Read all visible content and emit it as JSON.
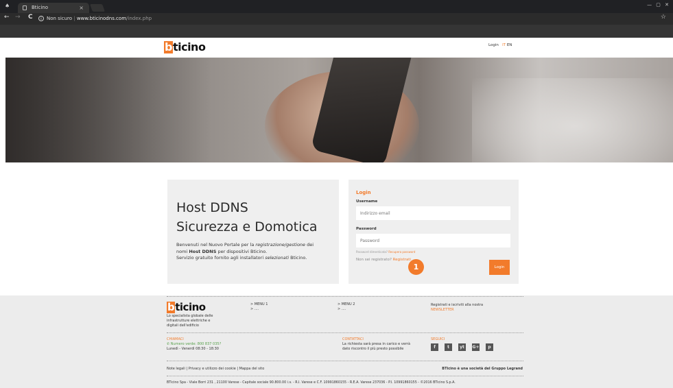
{
  "browser": {
    "tab_title": "Bticino",
    "tab_close": "×",
    "incognito_icon": "incognito-icon",
    "window_controls": "— ▢ ✕",
    "back": "←",
    "forward": "→",
    "reload": "C",
    "info_icon": "i",
    "security_label": "Non sicuro",
    "url_host": "www.bticinodns.com",
    "url_path": "/index.php",
    "star": "☆"
  },
  "header": {
    "logo_b": "b",
    "logo_rest": "ticino",
    "login_link": "Login",
    "lang_it": "IT",
    "lang_en": "EN"
  },
  "intro": {
    "title_line1": "Host DDNS",
    "title_line2": "Sicurezza e Domotica",
    "p1_a": "Benvenuti nel Nuovo Portale per la ",
    "p1_em": "registrazione/gestione",
    "p1_b": " dei",
    "p2_a": "nomi ",
    "p2_strong": "Host DDNS",
    "p2_b": " per dispositivi Bticino.",
    "p3_a": "Servizio gratuito fornito agli installatori ",
    "p3_em": "selezionati",
    "p3_b": " Bticino."
  },
  "login": {
    "title": "Login",
    "username_label": "Username",
    "username_placeholder": "Indirizzo email",
    "password_label": "Password",
    "password_placeholder": "Password",
    "forgot_text": "Password dimenticata?",
    "forgot_link": "Recupera password",
    "register_text": "Non sei registrato?",
    "register_link": "Registrati",
    "button": "Login",
    "marker": "1"
  },
  "footer": {
    "tagline_1": "Lo specialista globale delle",
    "tagline_2": "infrastrutture elettriche e",
    "tagline_3": "digitali dell'edificio",
    "menu1_title": "> MENU 1",
    "menu1_item": "> ....",
    "menu2_title": "> MENU 2",
    "menu2_item": "> ....",
    "newsletter_text": "Registrati e iscriviti alla nostra",
    "newsletter_link": "NEWSLETTER",
    "call_title": "CHIAMACI",
    "call_number": "Numero verde: 800 837 035?",
    "call_hours": "Lunedì - Venerdì 08:30 - 18:30",
    "contact_title": "CONTATTACI",
    "contact_1": "La richiesta sarà presa in carico e verrà",
    "contact_2": "dato riscontro il più presto possibile",
    "follow_title": "SEGUICI",
    "social": [
      "f",
      "t",
      "yt",
      "G+",
      "p"
    ],
    "links": "Note legali  | Privacy e utilizzo dei cookie  | Mappa del sito",
    "legrand": "BTicino è una società del Gruppo Legrand",
    "legal": "BTicino Spa - Viale Borri 231 , 21100 Varese - Capitale sociale 90.800.00 i.v. - R.I. Varese e C.F. 10991860155 - R.E.A. Varese 237036 - P.I. 10991860155 - ©2016 BTicino S.p.A."
  }
}
